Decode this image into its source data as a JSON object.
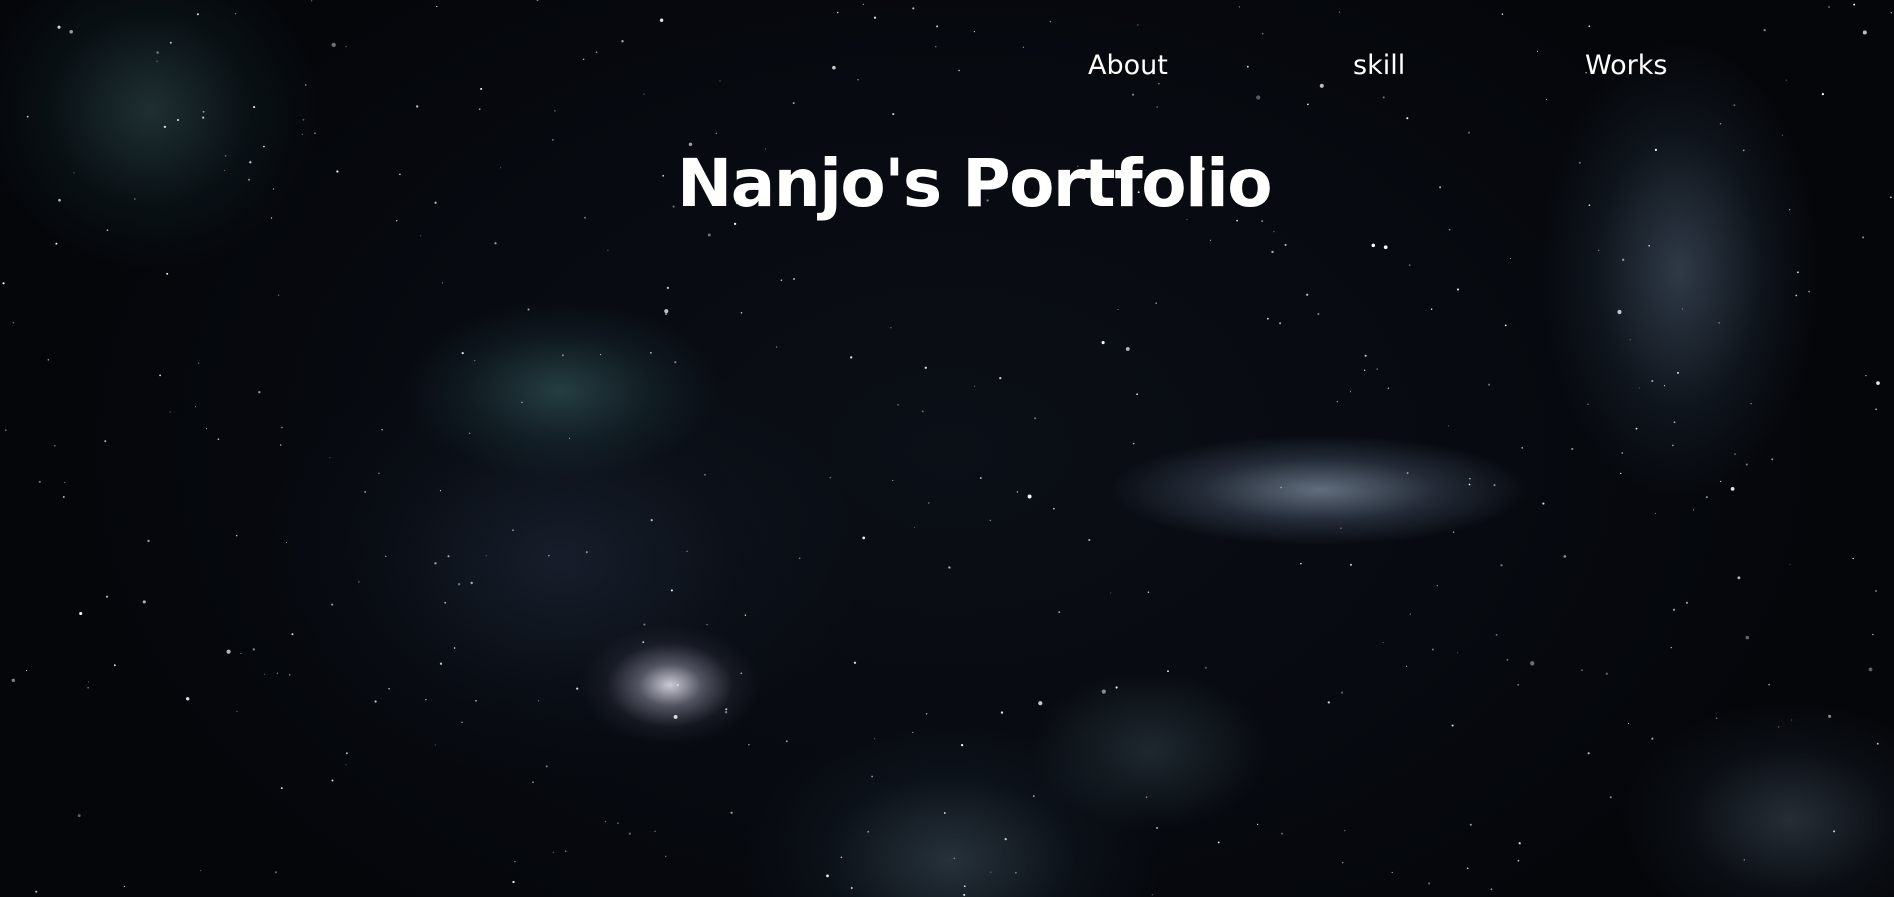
{
  "nav": {
    "items": [
      {
        "id": "about",
        "label": "About"
      },
      {
        "id": "skill",
        "label": "skill"
      },
      {
        "id": "works",
        "label": "Works"
      }
    ]
  },
  "hero": {
    "title": "Nanjo's Portfolio"
  },
  "colors": {
    "text": "#ffffff",
    "background": "#06080c",
    "nebula_teal": "#46787a",
    "nebula_blue": "#8aa0be"
  }
}
